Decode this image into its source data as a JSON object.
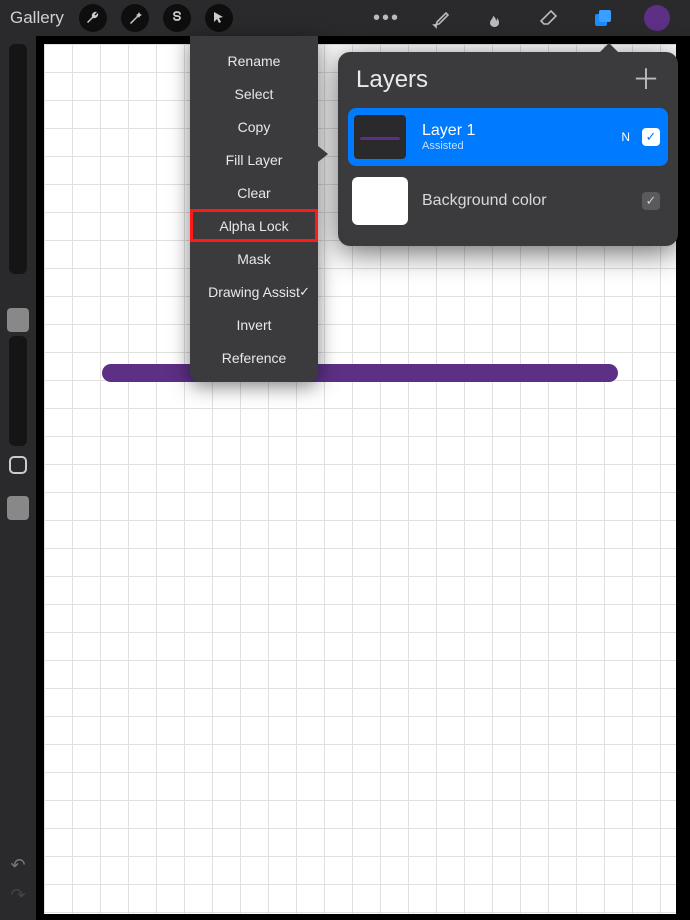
{
  "topbar": {
    "gallery": "Gallery"
  },
  "context_menu": {
    "items": [
      "Rename",
      "Select",
      "Copy",
      "Fill Layer",
      "Clear",
      "Alpha Lock",
      "Mask",
      "Drawing Assist",
      "Invert",
      "Reference"
    ],
    "highlighted": "Alpha Lock",
    "checked": "Drawing Assist"
  },
  "layers": {
    "title": "Layers",
    "items": [
      {
        "name": "Layer 1",
        "sub": "Assisted",
        "mode": "N",
        "visible": true,
        "selected": true
      },
      {
        "name": "Background color",
        "sub": "",
        "mode": "",
        "visible": true,
        "selected": false
      }
    ]
  },
  "colors": {
    "accent": "#5d2f85",
    "selection": "#007aff",
    "highlight_border": "#ff1a1a"
  }
}
